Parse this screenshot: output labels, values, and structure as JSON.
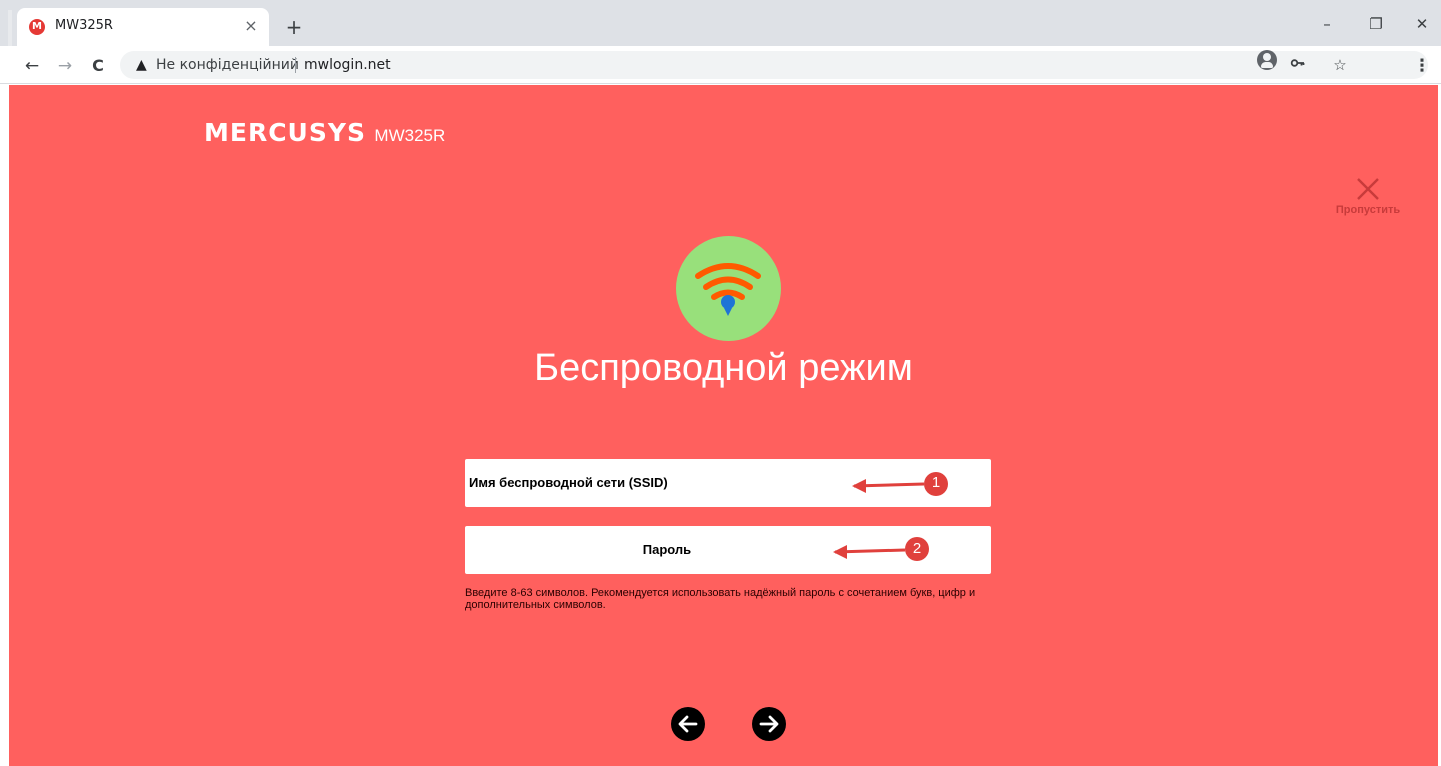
{
  "browser": {
    "tab_title": "MW325R",
    "tab_favicon_letter": "M",
    "new_tab_symbol": "+",
    "close_tab_symbol": "×",
    "window_controls": {
      "minimize": "–",
      "restore": "❐",
      "close": "✕"
    },
    "nav": {
      "back": "←",
      "forward": "→",
      "reload": "C"
    },
    "security_warning_icon": "warning-triangle-icon",
    "security_text": "Не конфіденційний",
    "url": "mwlogin.net",
    "toolbar_icons": {
      "key": "key-icon",
      "star": "☆",
      "menu": "⋮"
    }
  },
  "page": {
    "background_color": "#ff605e",
    "brand_logo": "MERCUSYS",
    "brand_model": "MW325R",
    "skip_label": "Пропустить",
    "title": "Беспроводной режим",
    "ssid_label": "Имя беспроводной сети (SSID)",
    "password_label": "Пароль",
    "annotation_1": "1",
    "annotation_2": "2",
    "hint": "Введите 8-63 символов. Рекомендуется использовать надёжный пароль с сочетанием букв, цифр и дополнительных символов.",
    "nav_prev_icon": "arrow-left-circle-icon",
    "nav_next_icon": "arrow-right-circle-icon",
    "wifi_icon": "wifi-icon"
  }
}
